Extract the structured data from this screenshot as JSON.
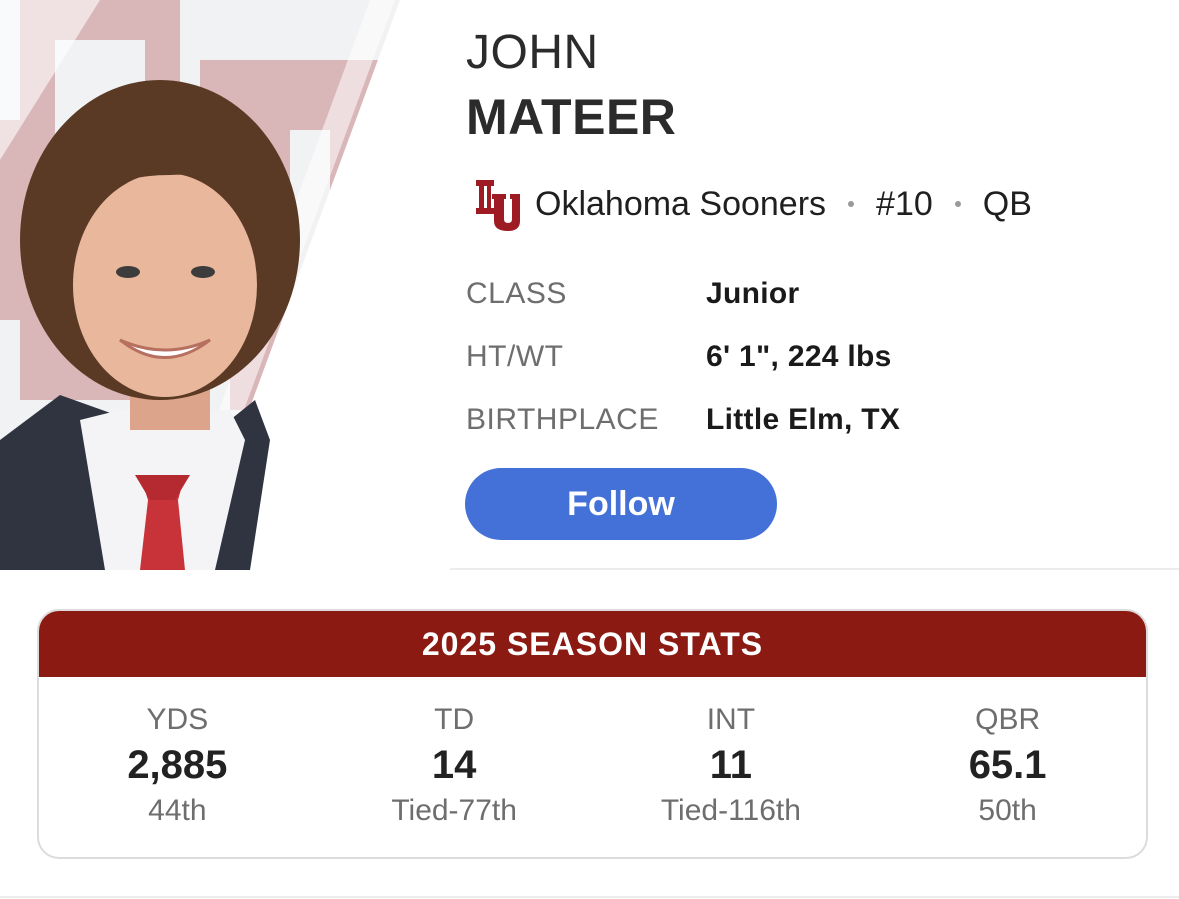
{
  "player": {
    "first_name": "JOHN",
    "last_name": "MATEER",
    "photo_icon": "player-headshot",
    "team_logo_icon": "oklahoma-ou-logo",
    "team": "Oklahoma Sooners",
    "number": "#10",
    "position": "QB"
  },
  "info": [
    {
      "label": "CLASS",
      "value": "Junior"
    },
    {
      "label": "HT/WT",
      "value": "6' 1\", 224 lbs"
    },
    {
      "label": "BIRTHPLACE",
      "value": "Little Elm, TX"
    }
  ],
  "follow_label": "Follow",
  "stats": {
    "title": "2025 SEASON STATS",
    "items": [
      {
        "label": "YDS",
        "value": "2,885",
        "rank": "44th"
      },
      {
        "label": "TD",
        "value": "14",
        "rank": "Tied-77th"
      },
      {
        "label": "INT",
        "value": "11",
        "rank": "Tied-116th"
      },
      {
        "label": "QBR",
        "value": "65.1",
        "rank": "50th"
      }
    ]
  },
  "colors": {
    "team_crimson": "#8b1b12",
    "follow_blue": "#4471d8",
    "label_gray": "#6e6e6e"
  }
}
